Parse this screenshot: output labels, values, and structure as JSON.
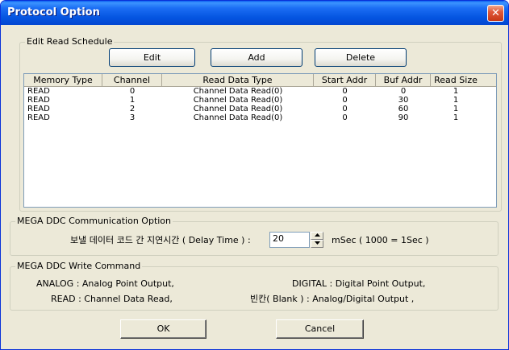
{
  "window": {
    "title": "Protocol Option",
    "close_symbol": "✕"
  },
  "schedule": {
    "legend": "Edit Read Schedule",
    "buttons": {
      "edit": "Edit",
      "add": "Add",
      "delete": "Delete"
    },
    "columns": [
      "Memory Type",
      "Channel",
      "Read Data Type",
      "Start Addr",
      "Buf Addr",
      "Read Size"
    ],
    "rows": [
      [
        "READ",
        "0",
        "Channel Data Read(0)",
        "0",
        "0",
        "1"
      ],
      [
        "READ",
        "1",
        "Channel Data Read(0)",
        "0",
        "30",
        "1"
      ],
      [
        "READ",
        "2",
        "Channel Data Read(0)",
        "0",
        "60",
        "1"
      ],
      [
        "READ",
        "3",
        "Channel Data Read(0)",
        "0",
        "90",
        "1"
      ]
    ]
  },
  "comm": {
    "legend": "MEGA DDC Communication Option",
    "delay_label": "보낼 데이터 코드 간 지연시간 ( Delay Time ) :",
    "delay_value": "20",
    "unit_label": "mSec ( 1000 = 1Sec )"
  },
  "write": {
    "legend": "MEGA DDC Write Command",
    "analog": "ANALOG : Analog Point Output,",
    "digital": "DIGITAL : Digital Point Output,",
    "read": "READ : Channel Data Read,",
    "blank": "빈칸( Blank ) : Analog/Digital Output ,"
  },
  "footer": {
    "ok": "OK",
    "cancel": "Cancel"
  },
  "icons": {
    "close": "close-icon",
    "spin_up": "spin-up-icon",
    "spin_down": "spin-down-icon"
  }
}
